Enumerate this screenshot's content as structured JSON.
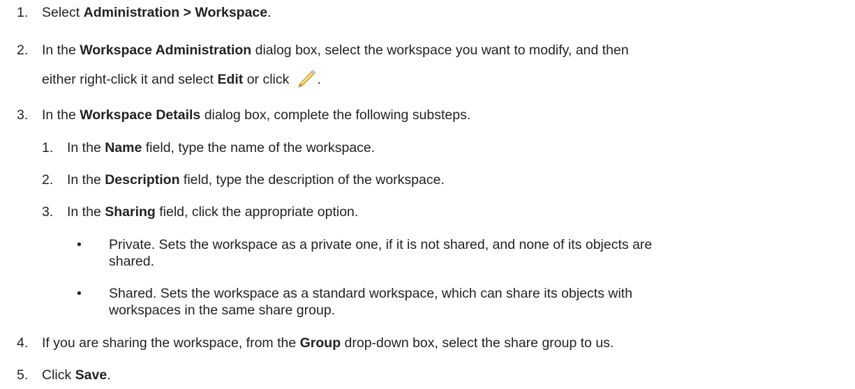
{
  "steps": [
    {
      "num": "1.",
      "pre": "Select ",
      "bold": "Administration > Workspace",
      "post": "."
    },
    {
      "num": "2.",
      "pre": "In the ",
      "bold": "Workspace Administration",
      "post": " dialog box, select the workspace you want to modify, and then",
      "line2_pre": "either right-click it and select ",
      "line2_bold": "Edit",
      "line2_post": " or click",
      "line2_end": ".",
      "icon": "pencil-edit-icon"
    },
    {
      "num": "3.",
      "pre": "In the ",
      "bold": "Workspace Details",
      "post": " dialog box, complete the following substeps."
    },
    {
      "num": "4.",
      "pre": "If you are sharing the workspace, from the ",
      "bold": "Group",
      "post": " drop-down box, select the share group to us."
    },
    {
      "num": "5.",
      "pre": "Click ",
      "bold": "Save",
      "post": "."
    }
  ],
  "substeps": [
    {
      "num": "1.",
      "pre": "In the ",
      "bold": "Name",
      "post": " field, type the name of the workspace."
    },
    {
      "num": "2.",
      "pre": "In the ",
      "bold": "Description",
      "post": " field, type the description of the workspace."
    },
    {
      "num": "3.",
      "pre": "In the ",
      "bold": "Sharing",
      "post": " field, click the appropriate option."
    }
  ],
  "options": [
    {
      "bullet": "•",
      "line1": "Private. Sets the workspace as a private one, if it is not shared, and none of its objects are",
      "line2": "shared."
    },
    {
      "bullet": "•",
      "line1": "Shared. Sets the workspace as a standard workspace, which can share its objects with",
      "line2": "workspaces in the same share group."
    }
  ],
  "colors": {
    "text": "#222222",
    "pencil_body": "#f5c24a",
    "pencil_tip": "#e8a05c"
  }
}
